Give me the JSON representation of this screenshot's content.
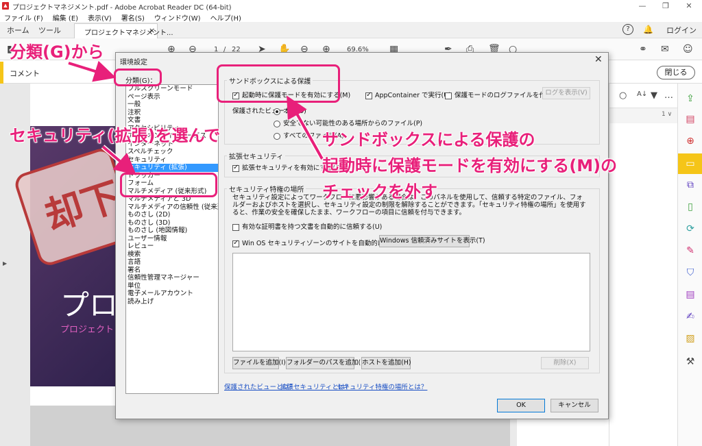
{
  "window": {
    "title": "プロジェクトマネジメント.pdf - Adobe Acrobat Reader DC (64-bit)",
    "minimize": "—",
    "restore": "❐",
    "close": "✕"
  },
  "menu": [
    "ファイル (F)",
    "編集 (E)",
    "表示(V)",
    "署名(S)",
    "ウィンドウ(W)",
    "ヘルプ(H)"
  ],
  "tabs": {
    "home": "ホーム",
    "tools": "ツール",
    "doc": "プロジェクトマネジメント...",
    "doc_close": "×",
    "help": "?",
    "bell": "🔔",
    "login": "ログイン"
  },
  "toolbar": {
    "page_current": "1",
    "page_sep": "/",
    "page_total": "22",
    "zoom": "69.6%"
  },
  "commentbar": {
    "label": "コメント",
    "close": "閉じる"
  },
  "document": {
    "stamp": "却下",
    "title": "プロジ",
    "subtitle": "プロジェクト"
  },
  "dialog": {
    "title": "環境設定",
    "close": "✕",
    "category_label": "分類(G)：",
    "categories": [
      "フルスクリーンモード",
      "ページ表示",
      "一般",
      "注釈",
      "文書",
      "アクセシビリティ",
      "アドビオンラインサービス",
      "インターネット",
      "スペルチェック",
      "セキュリティ",
      "セキュリティ (拡張)",
      "トラッカー",
      "フォーム",
      "マルチメディア (従来形式)",
      "マルチメディアと 3D",
      "マルチメディアの信頼性 (従来形式)",
      "ものさし (2D)",
      "ものさし (3D)",
      "ものさし (地図情報)",
      "ユーザー情報",
      "レビュー",
      "検索",
      "言語",
      "署名",
      "信頼性管理マネージャー",
      "単位",
      "電子メールアカウント",
      "読み上げ"
    ],
    "selected_index": 10,
    "sandbox": {
      "title": "サンドボックスによる保護",
      "protected_mode": "起動時に保護モードを有効にする(M)",
      "appcontainer": "AppContainer で実行(U)",
      "log_file": "保護モードのログファイルを作成(L)",
      "view_log": "ログを表示(V)",
      "protected_view_label": "保護されたビュー：",
      "pv_off": "オフ(O)",
      "pv_unsafe": "安全でない可能性のある場所からのファイル(P)",
      "pv_all": "すべてのファイル(A)"
    },
    "enhanced": {
      "title": "拡張セキュリティ",
      "enable": "拡張セキュリティを有効にする(E)"
    },
    "privileged": {
      "title": "セキュリティ特権の場所",
      "description": "セキュリティ設定によってワークフローに悪影響がある場合は、このパネルを使用して、信頼する特定のファイル、フォルダーおよびホストを選択し、セキュリティ設定の制限を解除することができます。「セキュリティ特権の場所」を使用すると、作業の安全を確保したまま、ワークフローの項目に信頼を付与できます。",
      "cert_trust": "有効な証明書を持つ文書を自動的に信頼する(U)",
      "win_zone": "Win OS セキュリティゾーンのサイトを自動的に信頼する(S)",
      "show_sites": "Windows 信頼済みサイトを表示(T)",
      "add_file": "ファイルを追加(I)",
      "add_folder": "フォルダーのパスを追加(D)",
      "add_host": "ホストを追加(H)",
      "delete": "削除(X)"
    },
    "links": {
      "pv": "保護されたビューとは？",
      "es": "拡張セキュリティとは？",
      "pl": "セキュリティ特権の場所とは？"
    },
    "ok": "OK",
    "cancel": "キャンセル"
  },
  "annotations": {
    "a1": "分類(G)から",
    "a2": "セキュリティ(拡張)を選んで",
    "a3_line1": "サンドボックスによる保護の",
    "a3_line2": "起動時に保護モードを有効にする(M)の",
    "a3_line3": "チェックを外す"
  },
  "colors": {
    "annotation": "#e8207a",
    "selection": "#3399ff",
    "comment_accent": "#f5c518"
  }
}
